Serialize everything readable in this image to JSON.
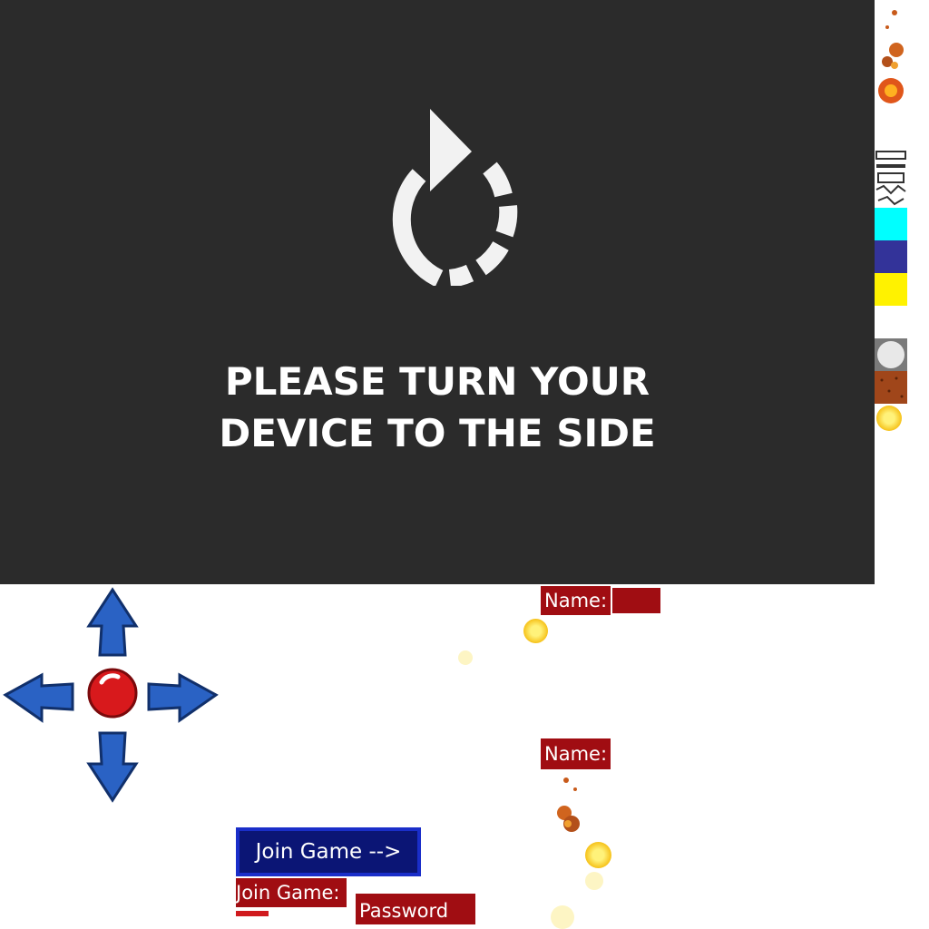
{
  "overlay": {
    "message_line1": "PLEASE TURN YOUR",
    "message_line2": "DEVICE TO THE SIDE",
    "icon": "rotate-device-icon",
    "background": "#2b2b2b"
  },
  "lobby": {
    "name_label": "Name:",
    "name_label_2": "Name:",
    "join_button": "Join Game -->",
    "join_label": "Join Game:",
    "password_placeholder": "Password"
  },
  "controls": {
    "dpad_icon": "dpad-arrows-icon",
    "action_button_icon": "red-button-icon"
  },
  "colors": {
    "label_bg": "#a00d12",
    "button_bg": "#0b1575",
    "button_border": "#1a2ec9",
    "swatch_cyan": "#00ffff",
    "swatch_blue": "#333399",
    "swatch_yellow": "#fff200",
    "swatch_brown": "#a0461a"
  }
}
